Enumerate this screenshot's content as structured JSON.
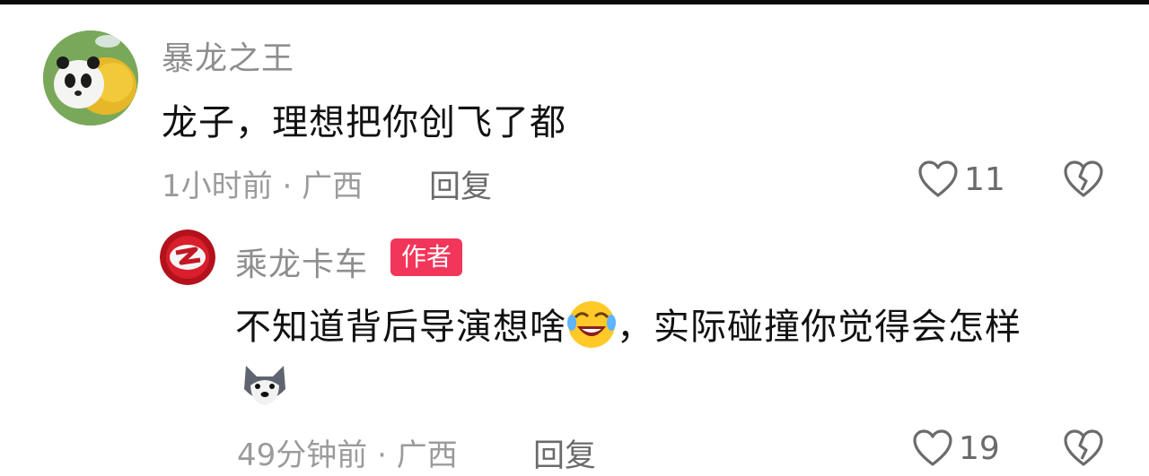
{
  "comment": {
    "username": "暴龙之王",
    "text": "龙子，理想把你创飞了都",
    "time": "1小时前",
    "separator": "·",
    "location": "广西",
    "reply_label": "回复",
    "likes": "11",
    "avatar_icon": "panda-bee-avatar"
  },
  "reply": {
    "username": "乘龙卡车",
    "badge": "作者",
    "text_part1": "不知道背后导演想啥",
    "emoji1": "laughing-crying-emoji",
    "text_part2": "，实际碰撞你觉得会怎样",
    "emoji2": "husky-dog-emoji",
    "time": "49分钟前",
    "separator": "·",
    "location": "广西",
    "reply_label": "回复",
    "likes": "19",
    "avatar_icon": "chenglong-logo-avatar"
  },
  "colors": {
    "badge_bg": "#f2365a",
    "username": "#8e8e8e",
    "meta": "#9b9b9b"
  }
}
